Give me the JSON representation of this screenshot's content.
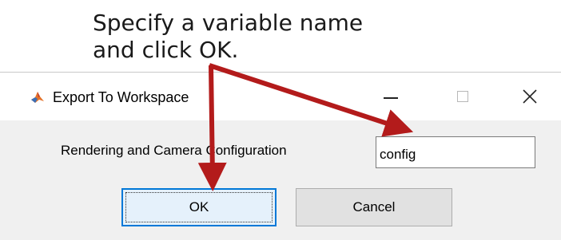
{
  "annotation": {
    "text": "Specify a variable name\nand click OK."
  },
  "dialog": {
    "title": "Export To Workspace",
    "icon": "matlab-icon",
    "window_controls": {
      "minimize": "minimize-icon",
      "maximize": "maximize-icon",
      "close": "close-icon"
    },
    "field": {
      "label": "Rendering and Camera Configuration",
      "value": "config"
    },
    "buttons": {
      "ok_label": "OK",
      "cancel_label": "Cancel"
    }
  },
  "colors": {
    "arrow": "#b31b1b",
    "ok_border": "#0078d7",
    "dialog_bg": "#f0f0f0"
  }
}
